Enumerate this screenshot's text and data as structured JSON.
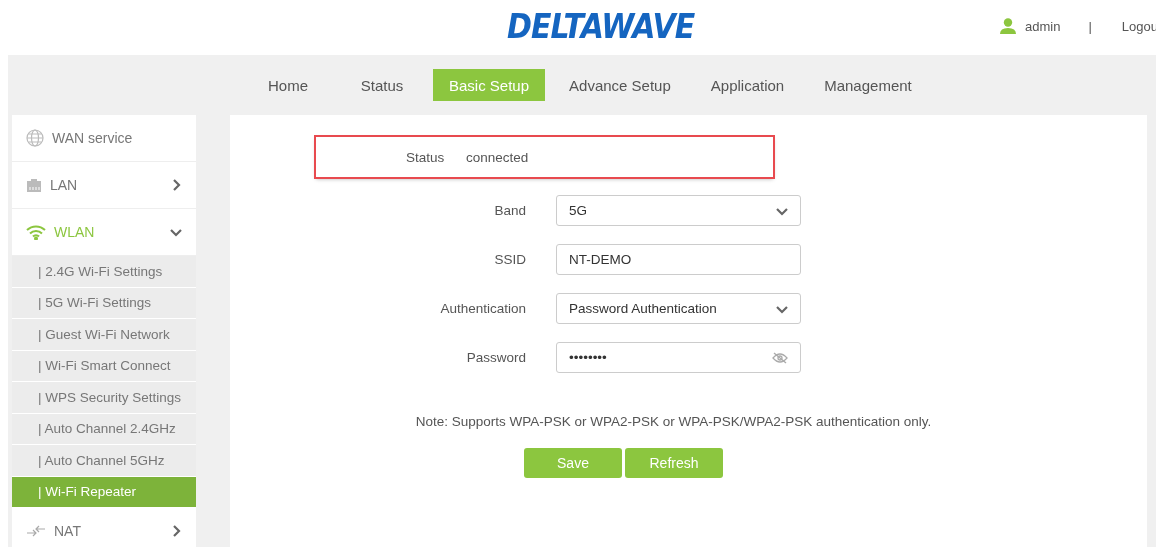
{
  "header": {
    "logo": "DELTAWAVE",
    "user": "admin",
    "separator": "|",
    "logout": "Logou"
  },
  "nav": {
    "tabs": [
      {
        "label": "Home",
        "selected": false
      },
      {
        "label": "Status",
        "selected": false
      },
      {
        "label": "Basic Setup",
        "selected": true
      },
      {
        "label": "Advance Setup",
        "selected": false
      },
      {
        "label": "Application",
        "selected": false
      },
      {
        "label": "Management",
        "selected": false
      }
    ]
  },
  "sidebar": {
    "items": [
      {
        "label": "WAN service",
        "expanded": false,
        "selected": false
      },
      {
        "label": "LAN",
        "expanded": false,
        "selected": false,
        "has_children": true
      },
      {
        "label": "WLAN",
        "expanded": true,
        "selected": true,
        "children": [
          {
            "label": "| 2.4G Wi-Fi Settings",
            "selected": false
          },
          {
            "label": "| 5G Wi-Fi Settings",
            "selected": false
          },
          {
            "label": "| Guest Wi-Fi Network",
            "selected": false
          },
          {
            "label": "| Wi-Fi Smart Connect",
            "selected": false
          },
          {
            "label": "| WPS Security Settings",
            "selected": false
          },
          {
            "label": "| Auto Channel 2.4GHz",
            "selected": false
          },
          {
            "label": "| Auto Channel 5GHz",
            "selected": false
          },
          {
            "label": "| Wi-Fi Repeater",
            "selected": true
          }
        ]
      },
      {
        "label": "NAT",
        "expanded": false,
        "selected": false,
        "has_children": true
      }
    ]
  },
  "form": {
    "fields": [
      {
        "label": "Status",
        "kind": "text",
        "value": "connected",
        "highlighted": true
      },
      {
        "label": "Band",
        "kind": "select",
        "value": "5G",
        "highlighted": false
      },
      {
        "label": "SSID",
        "kind": "input",
        "value": "NT-DEMO",
        "highlighted": false
      },
      {
        "label": "Authentication",
        "kind": "select",
        "value": "Password Authentication",
        "highlighted": false
      },
      {
        "label": "Password",
        "kind": "password",
        "value": "••••••••",
        "highlighted": false
      }
    ],
    "note": "Note: Supports WPA-PSK or WPA2-PSK or WPA-PSK/WPA2-PSK authentication only.",
    "buttons": [
      "Save",
      "Refresh"
    ]
  }
}
